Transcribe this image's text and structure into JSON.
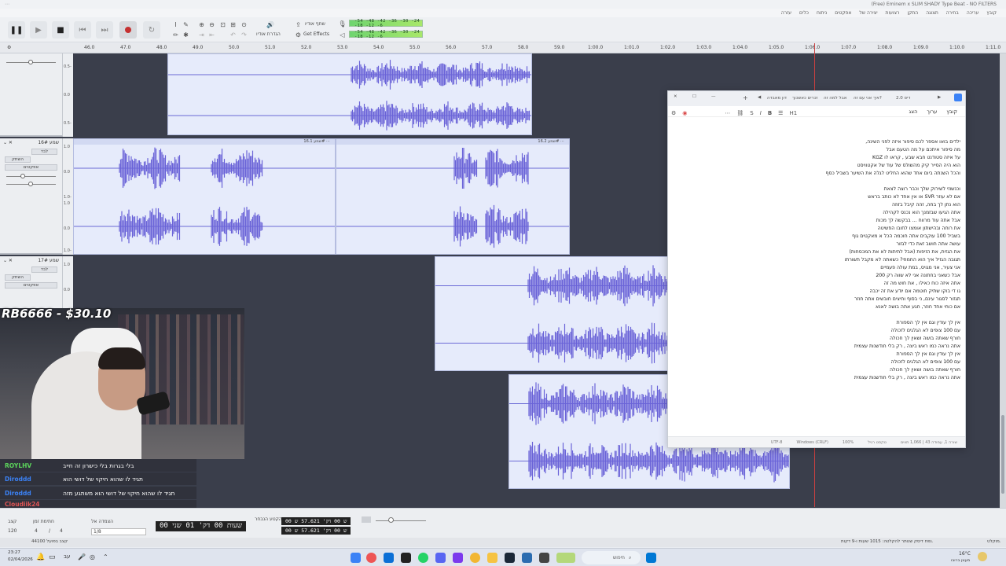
{
  "window": {
    "title": "(Free) Eminem x SLIM SHADY Type Beat - NO FILTERS"
  },
  "menu": [
    "קובץ",
    "עריכה",
    "בחירה",
    "תצוגה",
    "התקן",
    "רצועות",
    "יצירה של",
    "אפקטים",
    "ניתוח",
    "כלים",
    "עזרה"
  ],
  "toolbar": {
    "pause_icon": "pause-icon",
    "play_icon": "play-icon",
    "stop_icon": "stop-icon",
    "skip_start_icon": "skip-start-icon",
    "skip_end_icon": "skip-end-icon",
    "record_icon": "record-icon",
    "loop_icon": "loop-icon",
    "audio_setup_label": "הגדרת אודיו",
    "share_audio_label": "שתף אודיו",
    "get_effects_label": "Get Effects",
    "meter_scale": "-54 -48 -42 -36 -30 -24 -18 -12 -6"
  },
  "ruler": {
    "ticks": [
      "46.0",
      "47.0",
      "48.0",
      "49.0",
      "50.0",
      "51.0",
      "52.0",
      "53.0",
      "54.0",
      "55.0",
      "56.0",
      "57.0",
      "58.0",
      "59.0",
      "1:00.0",
      "1:01.0",
      "1:02.0",
      "1:03.0",
      "1:04.0",
      "1:05.0",
      "1:06.0",
      "1:07.0",
      "1:08.0",
      "1:09.0",
      "1:10.0",
      "1:11.0"
    ]
  },
  "tracks": [
    {
      "name": "שמע 16#",
      "mute": "השתק",
      "solo": "לבד",
      "effects": "אפקטים",
      "clips": [
        "16.1 שמע#",
        "16.2 שמע#"
      ]
    },
    {
      "name": "שמע 17#",
      "mute": "השתק",
      "solo": "לבד",
      "effects": "אפקטים",
      "clips": []
    }
  ],
  "scale_labels": [
    "1.0",
    "0.5-",
    "0.0",
    "0.5-",
    "1.0-"
  ],
  "stream": {
    "overlay_text": "RB6666 - $30.10"
  },
  "chat": [
    {
      "user": "ROYLHV",
      "color": "#5cd65c",
      "text": "בלי בגרות בלי כישרון זה חייב"
    },
    {
      "user": "Diroddd",
      "color": "#3b82f6",
      "text": "תגיד לו שהוא חיקוי של דושי הוא"
    },
    {
      "user": "Diroddd",
      "color": "#3b82f6",
      "text": "תגיד לו שהוא חיקוי של דושי הוא משתגע מזה"
    },
    {
      "user": "Cloudiik24",
      "color": "#e05555",
      "text": ""
    }
  ],
  "notepad": {
    "tabs": [
      "דיס 2.0",
      "איך אני עם זה?",
      "אבל למה זה",
      "זכרים כאשכוך",
      "דון מאבדה"
    ],
    "menu": [
      "קובץ",
      "ערוך",
      "הצג"
    ],
    "heading_label": "H1",
    "lines": [
      "ילדים בואו אספר לכם סיפור איזה לפני השינה,",
      "מה סיפור איתכם על מה הטעם אבל",
      "על איזה סטודנט חבא שבע , קראו לו KGZ",
      "הוא היה הסייר קיק מהשולס של עוד של אקטוויסט",
      "והכל השנתה ביום אחד שהוא החליט לגלה את השיער בשביל כסף",
      "",
      "וכנשוזי לשירוק שלך וכבר רוצה לצאת",
      "אם לא עוזר SVR או אין אחד לא כותב בראש",
      "הוא נתן לך בחה, זהה קיבל בזוזה",
      "אתה הגיעו שבזמנך הוא נכנס לקהילה",
      "אבל אתה עוד מרווח ... בבקשה לך מכות",
      "את רוחה ובהישתון אומצו לחובו הפשיטה",
      "בשביל 100 עוקבים אתה חוכמה הכל א מאקטים גוף",
      "עושה אתה חושב זאת כדי לגזור",
      "את הגזית, את הזיפות (אבל לתיתות לא את המכסחות)",
      "תגובה הגזיל איך הוא החמוזי? כשאתה לא מקבל תשורתו",
      "אני צעיר, אני מגויס, במת עולה פעמיים",
      "אבל כשאני בחתונה אני לא שווה רק 200",
      "אתה איזה כוח כאילו , את חוש מה זה",
      "גו די בוקו שתיק חוטמה אם יודע את זה יכבה",
      "תגזור לסגור עינם, ני בסוף וחיצים חובשים אתה חוזר",
      "אם כוחי אחד חוזר, חגע אתה בושה לאנא",
      "",
      "אין לך עודין וגם אין לך הספורת",
      "עם 100 צופים לא הגלגים לזכולה",
      "חורף שאתה בושה ושאין לך חכולה",
      "אתה נראה כמו ראש ביצה , רק בלי חודשנות עצמית",
      "אין לך עודין וגם אין לך הספורת",
      "עם 100 צופים לא הגלגים לזכולה",
      "חורף שאתה בושה ושאין לך חכולה",
      "אתה נראה כמו ראש ביצה , רק בלי חודשנות עצמית"
    ],
    "status": [
      "שורה 1, עמודה 43 | 1,066 תווים",
      "טקסט רגיל",
      "100%",
      "Windows (CRLF)",
      "UTF-8"
    ]
  },
  "selection": {
    "project_rate_label": "קצב",
    "project_rate_value": "120",
    "time_sig_label": "חתימת זמן",
    "time_sig_num": "4",
    "time_sig_den": "4",
    "snap_label": "הצמדה אל",
    "snap_value": "1/8",
    "main_time": "00 שעות 00 דק' 01 שני",
    "range_label": "הקטע הנבחר",
    "range_start": "00 ש 00 דק' 57.621 ש",
    "range_end": "00 ש 00 דק' 57.621 ש"
  },
  "status": {
    "left": "נפח דיסק שנותר להקלטה: 1015 שעות ו-9 דקות.",
    "right": "44100 קצב בפועל",
    "stopped": "מוקלט."
  },
  "taskbar": {
    "time": "23:27",
    "date": "02/04/2026",
    "search_placeholder": "חיפוש",
    "weather": "16°C",
    "weather_desc": "מעונן ברובו"
  }
}
